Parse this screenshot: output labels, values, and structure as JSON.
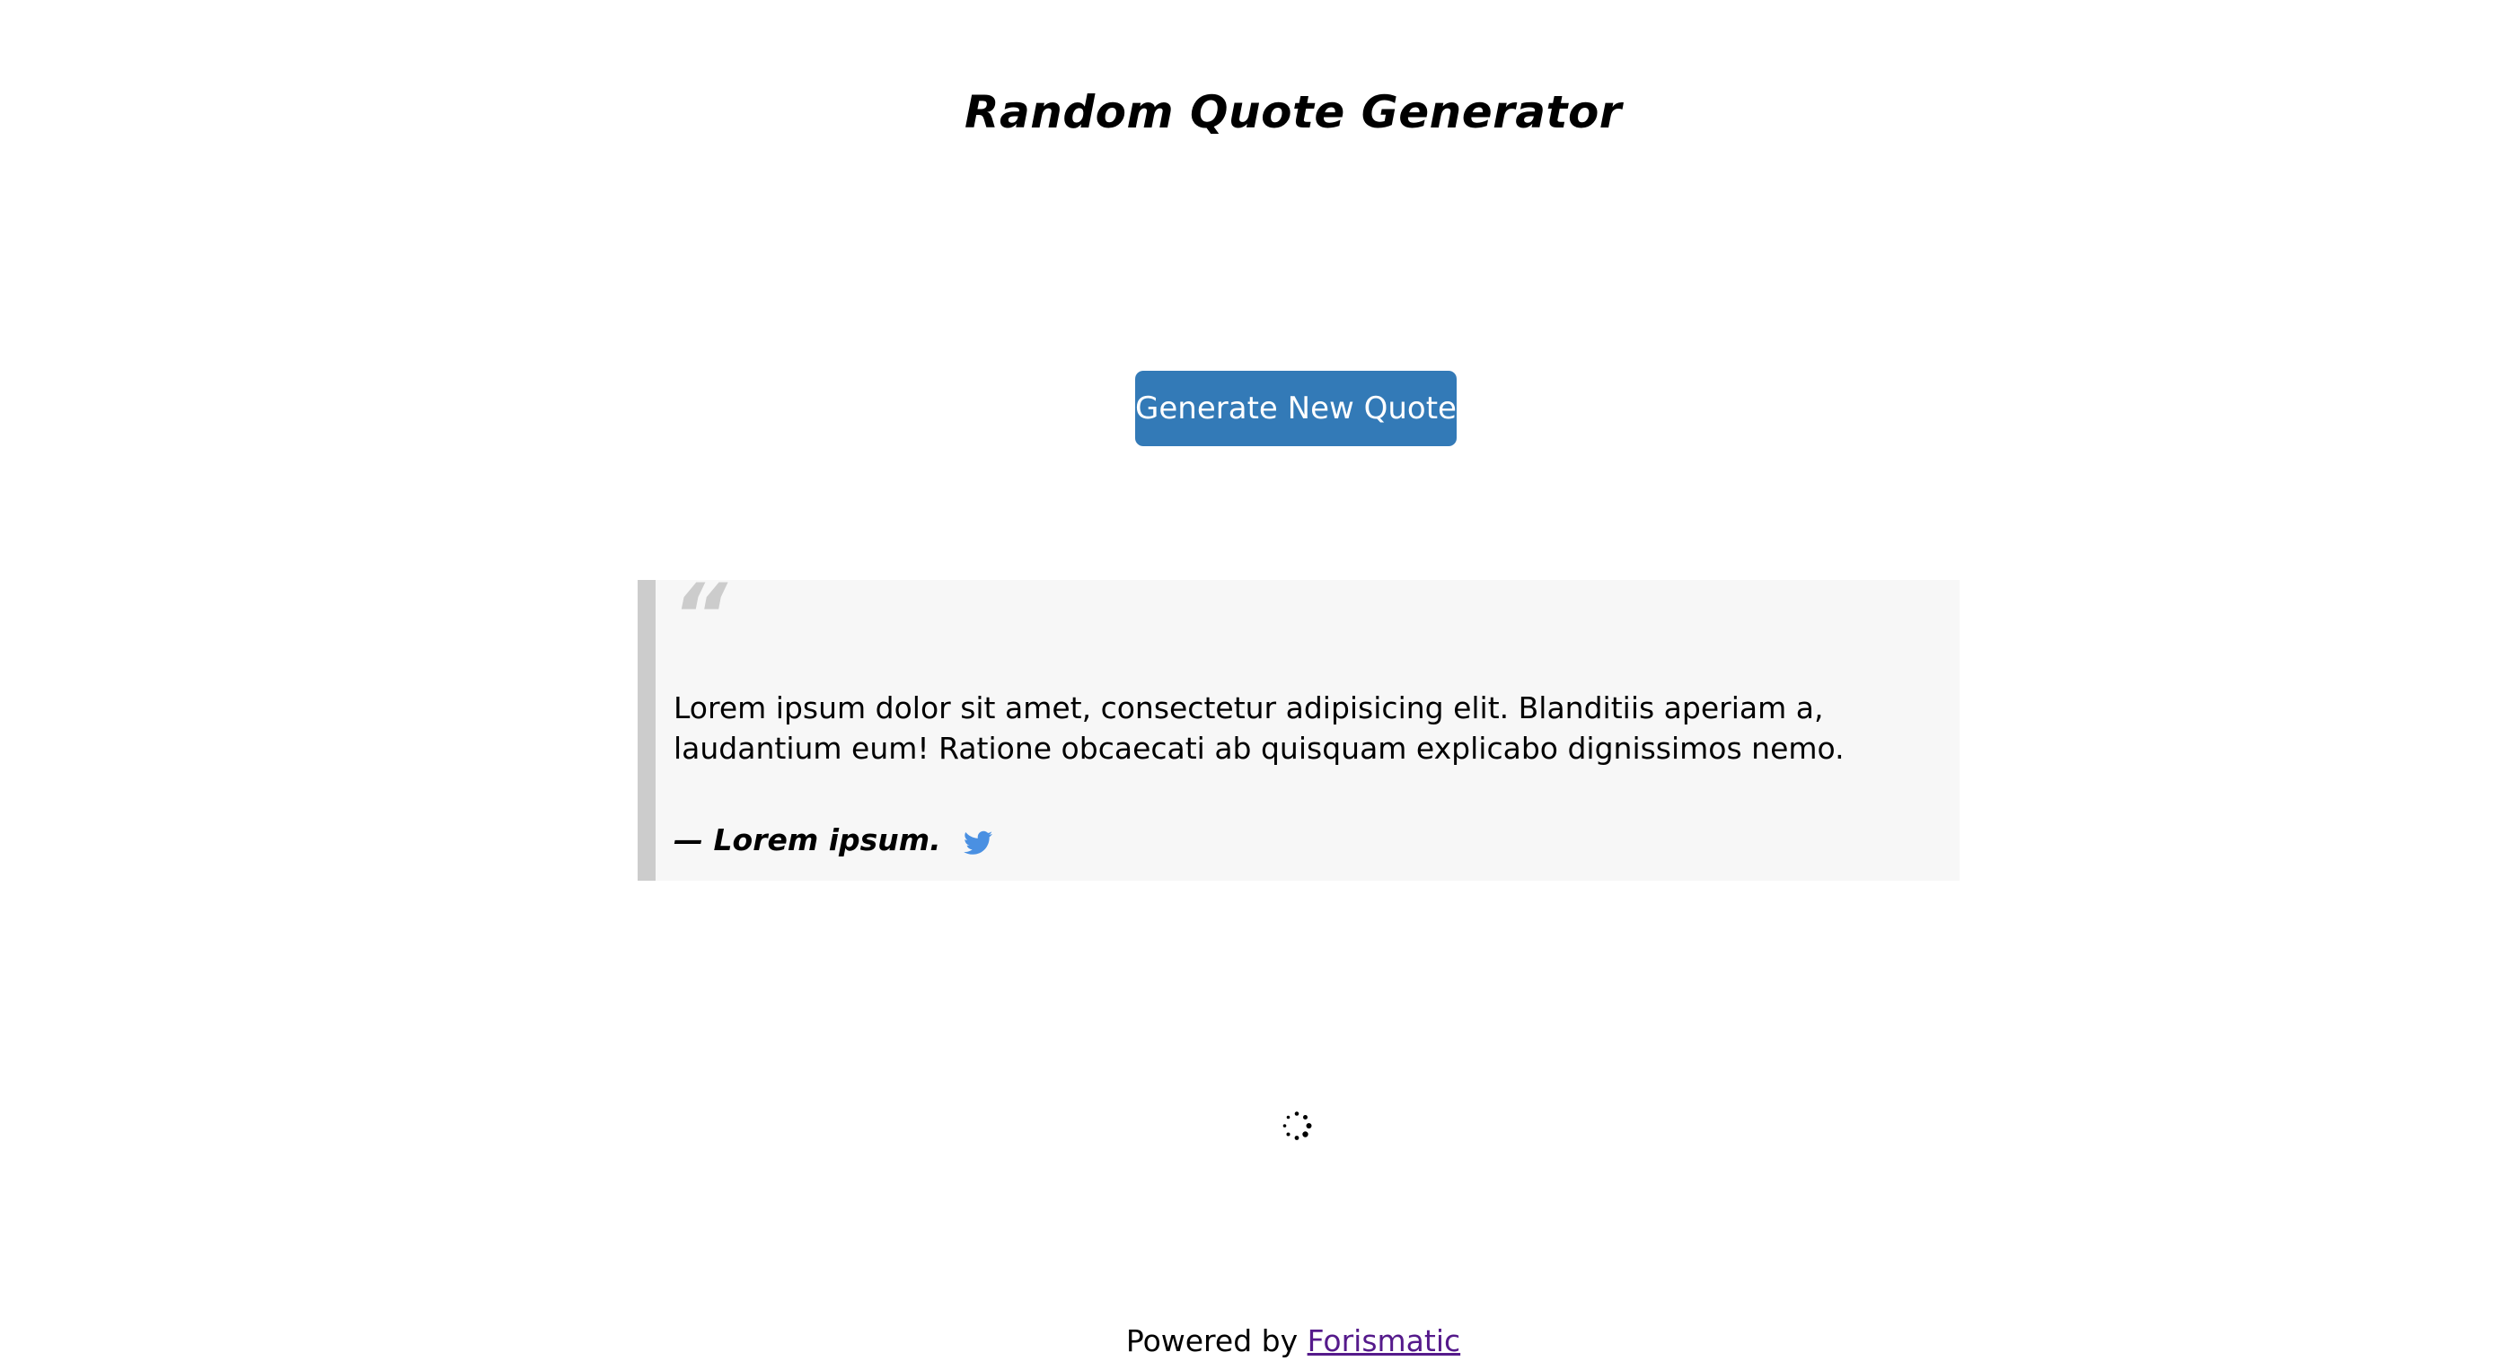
{
  "page": {
    "title": "Random Quote Generator"
  },
  "controls": {
    "generate_label": "Generate New Quote"
  },
  "quote": {
    "mark": "“",
    "text": "Lorem ipsum dolor sit amet, consectetur adipisicing elit. Blanditiis aperiam a, laudantium eum! Ratione obcaecati ab quisquam explicabo dignissimos nemo.",
    "author": "— Lorem ipsum.",
    "share_icon": "twitter-icon"
  },
  "loading": {
    "icon": "spinner-icon"
  },
  "footer": {
    "prefix": "Powered by ",
    "link_text": "Forismatic"
  },
  "colors": {
    "button_bg": "#337ab7",
    "quote_bg": "#f7f7f7",
    "quote_border": "#cccccc",
    "twitter": "#4a90e2",
    "link_visited": "#551a8b"
  }
}
